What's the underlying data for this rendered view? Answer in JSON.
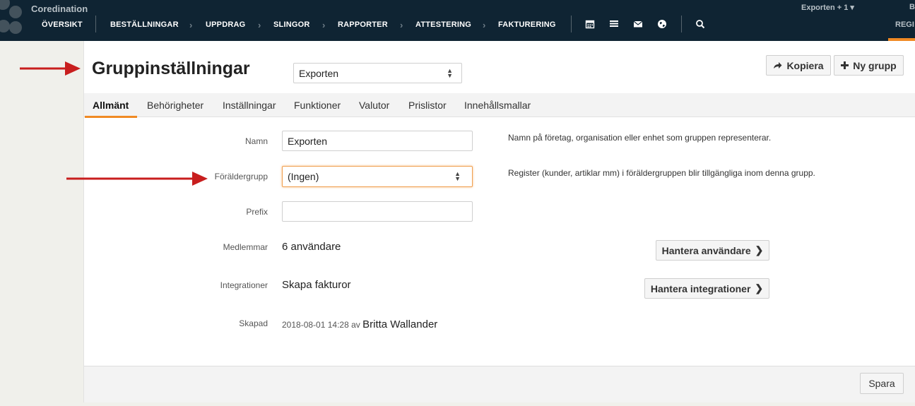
{
  "app": {
    "brand": "Coredination"
  },
  "nav": {
    "items": [
      "ÖVERSIKT",
      "BESTÄLLNINGAR",
      "UPPDRAG",
      "SLINGOR",
      "RAPPORTER",
      "ATTESTERING",
      "FAKTURERING"
    ],
    "icons": [
      "calendar-icon",
      "list-icon",
      "mail-icon",
      "globe-icon",
      "search-icon"
    ],
    "group_switch": "Exporten + 1",
    "cut_letter": "B",
    "reg_tab": "REGI"
  },
  "header": {
    "title": "Gruppinställningar",
    "group_select": "Exporten",
    "copy_button": "Kopiera",
    "new_group_button": "Ny grupp"
  },
  "tabs": [
    "Allmänt",
    "Behörigheter",
    "Inställningar",
    "Funktioner",
    "Valutor",
    "Prislistor",
    "Innehållsmallar"
  ],
  "form": {
    "name_label": "Namn",
    "name_value": "Exporten",
    "name_help": "Namn på företag, organisation eller enhet som gruppen representerar.",
    "parent_label": "Föräldergrupp",
    "parent_value": "(Ingen)",
    "parent_help": "Register (kunder, artiklar mm) i föräldergruppen blir tillgängliga inom denna grupp.",
    "prefix_label": "Prefix",
    "prefix_value": "",
    "members_label": "Medlemmar",
    "members_value": "6 användare",
    "members_button": "Hantera användare",
    "integrations_label": "Integrationer",
    "integrations_value": "Skapa fakturor",
    "integrations_button": "Hantera integrationer",
    "created_label": "Skapad",
    "created_date": "2018-08-01 14:28",
    "created_by_word": "av",
    "created_by": "Britta Wallander"
  },
  "footer": {
    "save_button": "Spara"
  },
  "colors": {
    "nav_bg": "#0f2433",
    "accent": "#f08a24",
    "annotation_arrow": "#c81e1e"
  }
}
